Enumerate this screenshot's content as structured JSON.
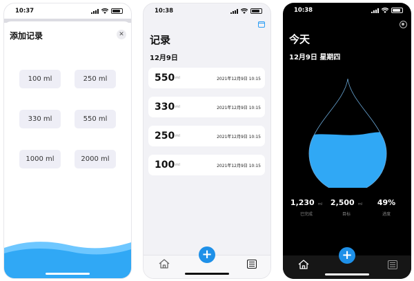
{
  "colors": {
    "accent": "#1e90e8",
    "water": "#30a8f5",
    "water_light": "#6ec7ff"
  },
  "screen1": {
    "status_time": "10:37",
    "title": "添加记录",
    "close_icon": "close-icon",
    "options": [
      "100 ml",
      "250 ml",
      "330 ml",
      "550 ml",
      "1000 ml",
      "2000 ml"
    ]
  },
  "screen2": {
    "status_time": "10:38",
    "title": "记录",
    "date": "12月9日",
    "unit": "ml",
    "records": [
      {
        "amount": "550",
        "time": "2021年12月9日 10:15"
      },
      {
        "amount": "330",
        "time": "2021年12月9日 10:15"
      },
      {
        "amount": "250",
        "time": "2021年12月9日 10:15"
      },
      {
        "amount": "100",
        "time": "2021年12月9日 10:15"
      }
    ],
    "tabs": {
      "home_icon": "home-icon",
      "add_icon": "plus-icon",
      "add_label": "+",
      "list_icon": "list-icon"
    }
  },
  "screen3": {
    "status_time": "10:38",
    "title": "今天",
    "date": "12月9日 星期四",
    "progress_fraction": 0.49,
    "stats": [
      {
        "value": "1,230",
        "unit": "ml",
        "label": "已完成"
      },
      {
        "value": "2,500",
        "unit": "ml",
        "label": "目标"
      },
      {
        "value": "49%",
        "unit": "",
        "label": "进度"
      }
    ],
    "add_label": "+"
  }
}
